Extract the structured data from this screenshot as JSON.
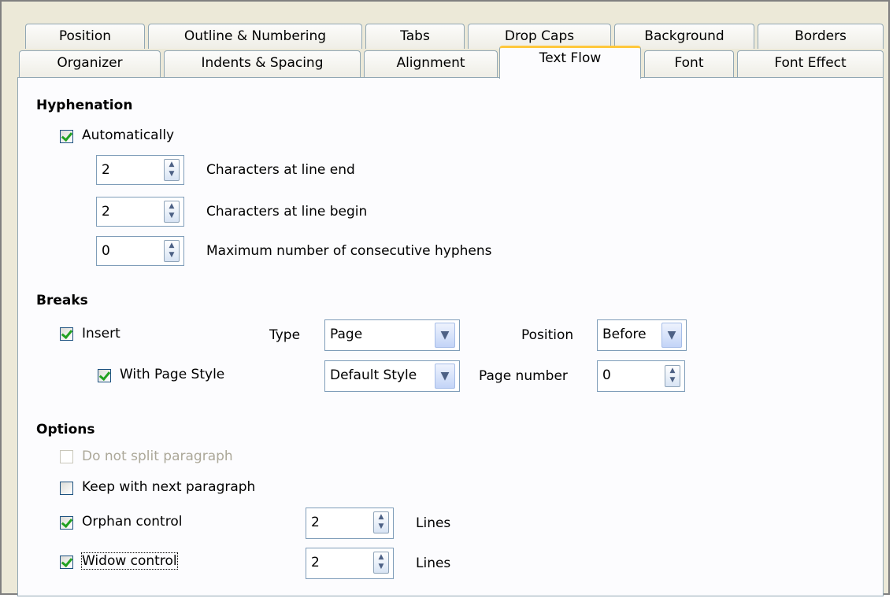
{
  "tabs_row1": [
    "Position",
    "Outline & Numbering",
    "Tabs",
    "Drop Caps",
    "Background",
    "Borders"
  ],
  "tabs_row2": [
    "Organizer",
    "Indents & Spacing",
    "Alignment",
    "Text Flow",
    "Font",
    "Font Effect"
  ],
  "active_tab": "Text Flow",
  "hyphenation": {
    "heading": "Hyphenation",
    "automatically_label": "Automatically",
    "automatically_checked": true,
    "line_end_value": "2",
    "line_end_label": "Characters at line end",
    "line_begin_value": "2",
    "line_begin_label": "Characters at line begin",
    "max_hyphens_value": "0",
    "max_hyphens_label": "Maximum number of consecutive hyphens"
  },
  "breaks": {
    "heading": "Breaks",
    "insert_label": "Insert",
    "insert_checked": true,
    "type_label": "Type",
    "type_value": "Page",
    "position_label": "Position",
    "position_value": "Before",
    "with_page_style_label": "With Page Style",
    "with_page_style_checked": true,
    "page_style_value": "Default Style",
    "page_number_label": "Page number",
    "page_number_value": "0"
  },
  "options": {
    "heading": "Options",
    "do_not_split_label": "Do not split paragraph",
    "do_not_split_checked": false,
    "do_not_split_disabled": true,
    "keep_with_next_label": "Keep with next paragraph",
    "keep_with_next_checked": false,
    "orphan_label": "Orphan control",
    "orphan_checked": true,
    "orphan_value": "2",
    "orphan_unit": "Lines",
    "widow_label": "Widow control",
    "widow_checked": true,
    "widow_value": "2",
    "widow_unit": "Lines"
  }
}
